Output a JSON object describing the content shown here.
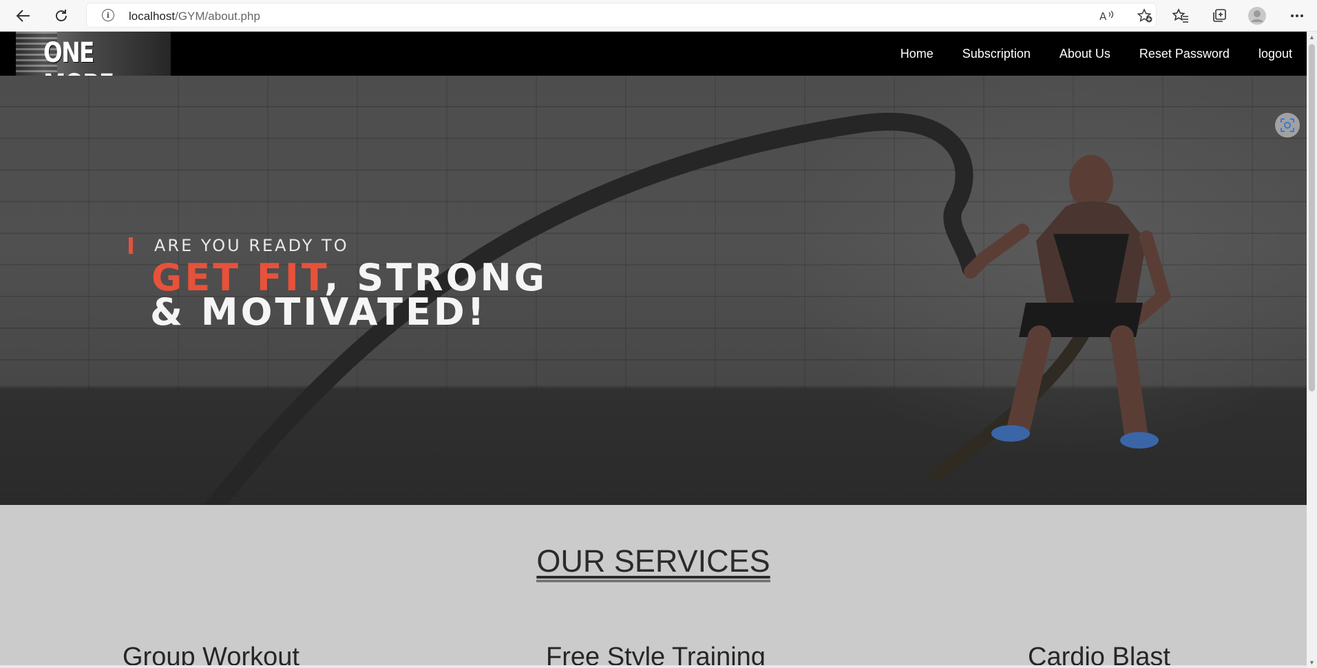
{
  "browser": {
    "url_host": "localhost",
    "url_path": "/GYM/about.php",
    "icons": [
      "back-icon",
      "refresh-icon",
      "info-icon",
      "read-aloud-icon",
      "add-favorite-icon",
      "favorites-icon",
      "collections-icon",
      "profile-icon",
      "more-icon"
    ]
  },
  "site": {
    "logo": "ONE MORE",
    "nav": [
      "Home",
      "Subscription",
      "About Us",
      "Reset Password",
      "logout"
    ]
  },
  "hero": {
    "line1": "ARE YOU READY TO",
    "line2_accent": "GET FIT",
    "line2_rest": ", STRONG",
    "line3": "& MOTIVATED!"
  },
  "services": {
    "title": "OUR SERVICES",
    "items": [
      "Group Workout",
      "Free Style Training",
      "Cardio Blast"
    ]
  },
  "colors": {
    "accent": "#e8513a",
    "nav_bg": "#000000",
    "page_bg": "#cbcbcb"
  }
}
